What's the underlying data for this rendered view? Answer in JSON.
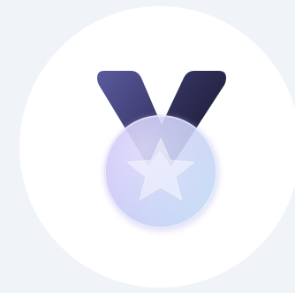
{
  "illustration": {
    "icon": "medal-icon",
    "colors": {
      "background": "#f0f3f7",
      "disc": "#ffffff",
      "ribbon_light": "#5b5a9e",
      "ribbon_dark": "#15152a",
      "medal_violet": "#c9b8f7",
      "medal_blue": "#c3dbf5",
      "star": "#ffffff"
    }
  }
}
